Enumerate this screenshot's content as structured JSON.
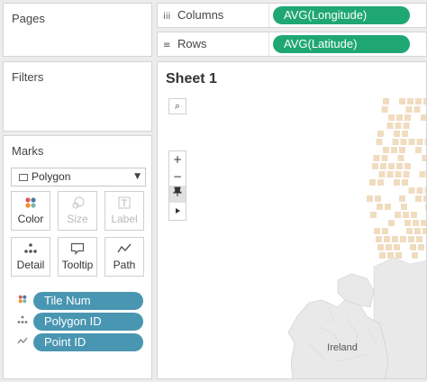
{
  "cards": {
    "pages": "Pages",
    "filters": "Filters",
    "marks": "Marks"
  },
  "shelves": {
    "columns": {
      "icon": "iii",
      "label": "Columns",
      "pill": "AVG(Longitude)"
    },
    "rows": {
      "icon": "≡",
      "label": "Rows",
      "pill": "AVG(Latitude)"
    }
  },
  "marks": {
    "mark_type": "Polygon",
    "buttons": [
      {
        "label": "Color",
        "icon": "color-icon"
      },
      {
        "label": "Size",
        "icon": "size-icon"
      },
      {
        "label": "Label",
        "icon": "label-icon"
      },
      {
        "label": "Detail",
        "icon": "detail-icon"
      },
      {
        "label": "Tooltip",
        "icon": "tooltip-icon"
      },
      {
        "label": "Path",
        "icon": "path-icon"
      }
    ],
    "fields": [
      {
        "label": "Tile Num",
        "icon": "color-icon"
      },
      {
        "label": "Polygon ID",
        "icon": "detail-icon"
      },
      {
        "label": "Point ID",
        "icon": "path-icon"
      }
    ]
  },
  "view": {
    "sheet_title": "Sheet 1",
    "map_label": "Ireland",
    "tile_color": "#f1dcc0",
    "land_color": "#e9e9e9",
    "pill_green": "#1fa773",
    "pill_blue": "#4996b2"
  }
}
